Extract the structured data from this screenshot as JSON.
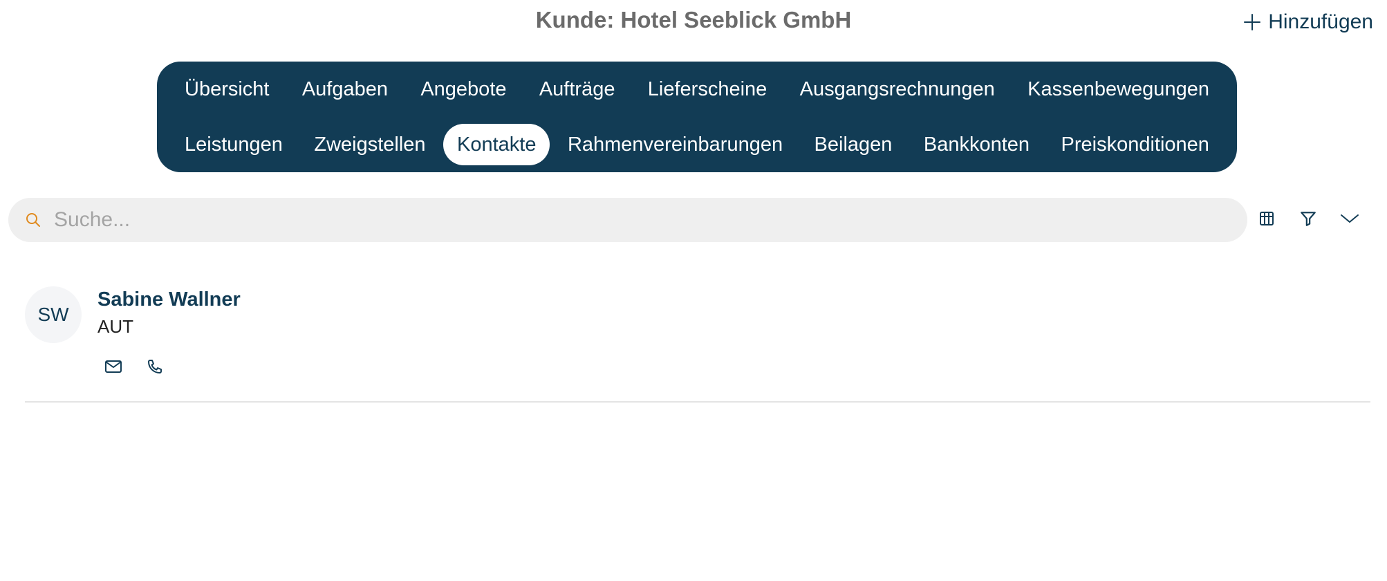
{
  "header": {
    "title": "Kunde: Hotel Seeblick GmbH",
    "add_label": "Hinzufügen",
    "add_icon": "plus-icon"
  },
  "tabs": {
    "row1": [
      "Übersicht",
      "Aufgaben",
      "Angebote",
      "Aufträge",
      "Lieferscheine",
      "Ausgangsrechnungen",
      "Kassenbewegungen"
    ],
    "row2": [
      "Leistungen",
      "Zweigstellen",
      "Kontakte",
      "Rahmenvereinbarungen",
      "Beilagen",
      "Bankkonten",
      "Preiskonditionen"
    ],
    "active": "Kontakte"
  },
  "search": {
    "placeholder": "Suche...",
    "value": "",
    "icon": "search-icon"
  },
  "toolbar": {
    "icons": [
      "table-columns-icon",
      "filter-icon",
      "chevron-down-icon"
    ]
  },
  "contacts": [
    {
      "initials": "SW",
      "name": "Sabine Wallner",
      "country": "AUT",
      "actions": [
        "mail-icon",
        "phone-icon"
      ]
    }
  ],
  "colors": {
    "primary": "#123c55",
    "title_gray": "#6b6b6b",
    "search_bg": "#efefef",
    "search_icon": "#e08a1e",
    "divider": "#e4e4e4"
  }
}
